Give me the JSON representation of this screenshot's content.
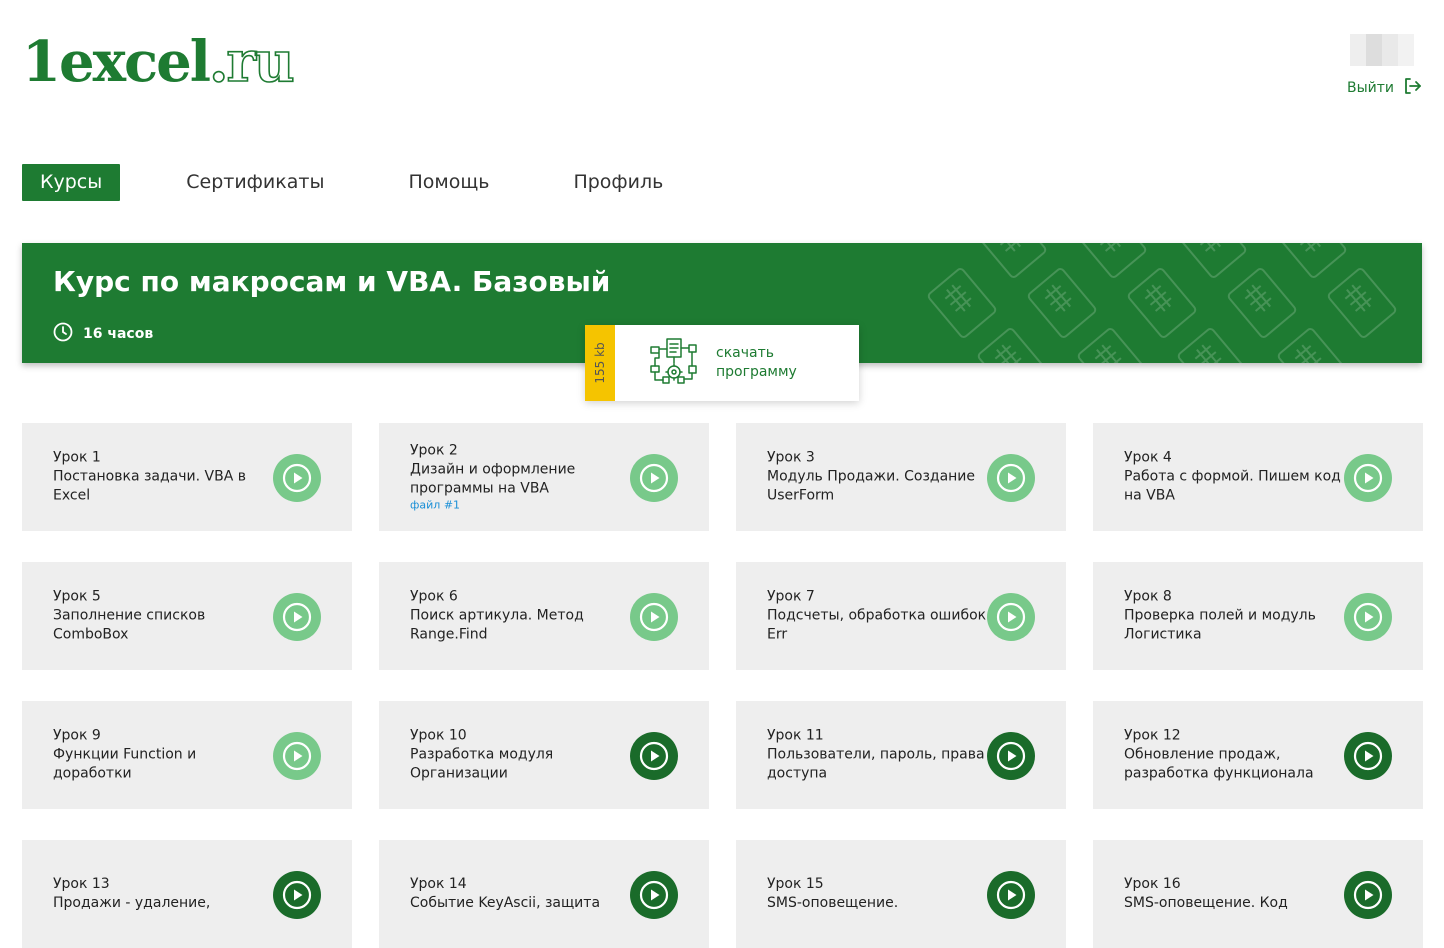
{
  "header": {
    "logo_part1": "1excel",
    "logo_part2": ".ru",
    "logout_label": "Выйти"
  },
  "nav": {
    "items": [
      {
        "label": "Курсы",
        "active": true
      },
      {
        "label": "Сертификаты",
        "active": false
      },
      {
        "label": "Помощь",
        "active": false
      },
      {
        "label": "Профиль",
        "active": false
      }
    ]
  },
  "course": {
    "title": "Курс по макросам и VBA. Базовый",
    "duration": "16 часов",
    "pattern_text": "XLS"
  },
  "download": {
    "size": "155 kb",
    "line1": "скачать",
    "line2": "программу"
  },
  "colors": {
    "brand_green": "#1e7b32",
    "play_light": "#78c98a",
    "play_dark": "#1a6b2a",
    "badge_yellow": "#f5c400",
    "link_blue": "#1a8fd6"
  },
  "lessons": [
    {
      "num": "Урок 1",
      "title": "Постановка задачи. VBA в Excel",
      "file": "",
      "status": "watched"
    },
    {
      "num": "Урок 2",
      "title": "Дизайн и оформление программы на VBA",
      "file": "файл #1",
      "status": "watched"
    },
    {
      "num": "Урок 3",
      "title": "Модуль Продажи. Создание UserForm",
      "file": "",
      "status": "watched"
    },
    {
      "num": "Урок 4",
      "title": "Работа с формой. Пишем код на VBA",
      "file": "",
      "status": "watched"
    },
    {
      "num": "Урок 5",
      "title": "Заполнение списков ComboBox",
      "file": "",
      "status": "watched"
    },
    {
      "num": "Урок 6",
      "title": "Поиск артикула. Метод Range.Find",
      "file": "",
      "status": "watched"
    },
    {
      "num": "Урок 7",
      "title": "Подсчеты, обработка ошибок Err",
      "file": "",
      "status": "watched"
    },
    {
      "num": "Урок 8",
      "title": "Проверка полей и модуль Логистика",
      "file": "",
      "status": "watched"
    },
    {
      "num": "Урок 9",
      "title": "Функции Function и доработки",
      "file": "",
      "status": "watched"
    },
    {
      "num": "Урок 10",
      "title": "Разработка модуля Организации",
      "file": "",
      "status": "new"
    },
    {
      "num": "Урок 11",
      "title": "Пользователи, пароль, права доступа",
      "file": "",
      "status": "new"
    },
    {
      "num": "Урок 12",
      "title": "Обновление продаж, разработка функционала",
      "file": "",
      "status": "new"
    },
    {
      "num": "Урок 13",
      "title": "Продажи - удаление,",
      "file": "",
      "status": "new"
    },
    {
      "num": "Урок 14",
      "title": "Событие KeyAscii, защита",
      "file": "",
      "status": "new"
    },
    {
      "num": "Урок 15",
      "title": "SMS-оповещение.",
      "file": "",
      "status": "new"
    },
    {
      "num": "Урок 16",
      "title": "SMS-оповещение. Код",
      "file": "",
      "status": "new"
    }
  ]
}
